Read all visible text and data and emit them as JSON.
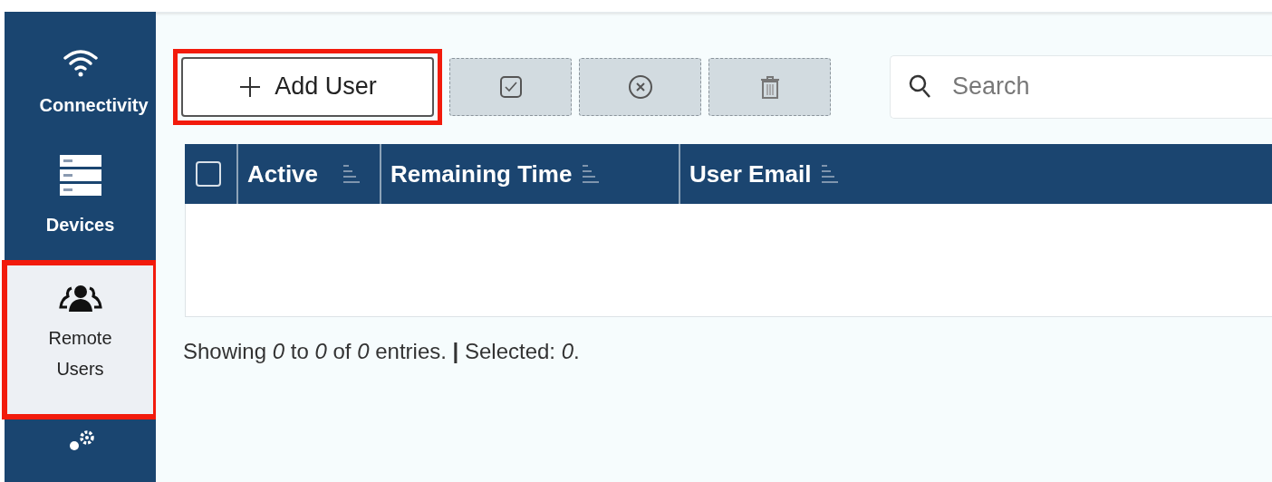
{
  "sidebar": {
    "items": [
      {
        "kind": "wifi",
        "label": "Connectivity",
        "selected": false,
        "highlighted": false
      },
      {
        "kind": "server",
        "label": "Devices",
        "selected": false,
        "highlighted": false
      },
      {
        "kind": "users",
        "label": "Remote Users",
        "selected": true,
        "highlighted": true
      },
      {
        "kind": "settings",
        "selected": false,
        "highlighted": false
      }
    ]
  },
  "toolbar": {
    "add_button": {
      "label": "Add User",
      "highlighted": true
    },
    "icon_buttons": [
      {
        "kind": "check",
        "disabled": true
      },
      {
        "kind": "cancel",
        "disabled": true
      },
      {
        "kind": "trash",
        "disabled": true
      }
    ],
    "search": {
      "placeholder": "Search"
    }
  },
  "table": {
    "select_all_checked": false,
    "columns": [
      "Active",
      "Remaining Time",
      "User Email"
    ]
  },
  "footer": "Showing *0* to *0* of *0* entries. **|** Selected: *0*."
}
